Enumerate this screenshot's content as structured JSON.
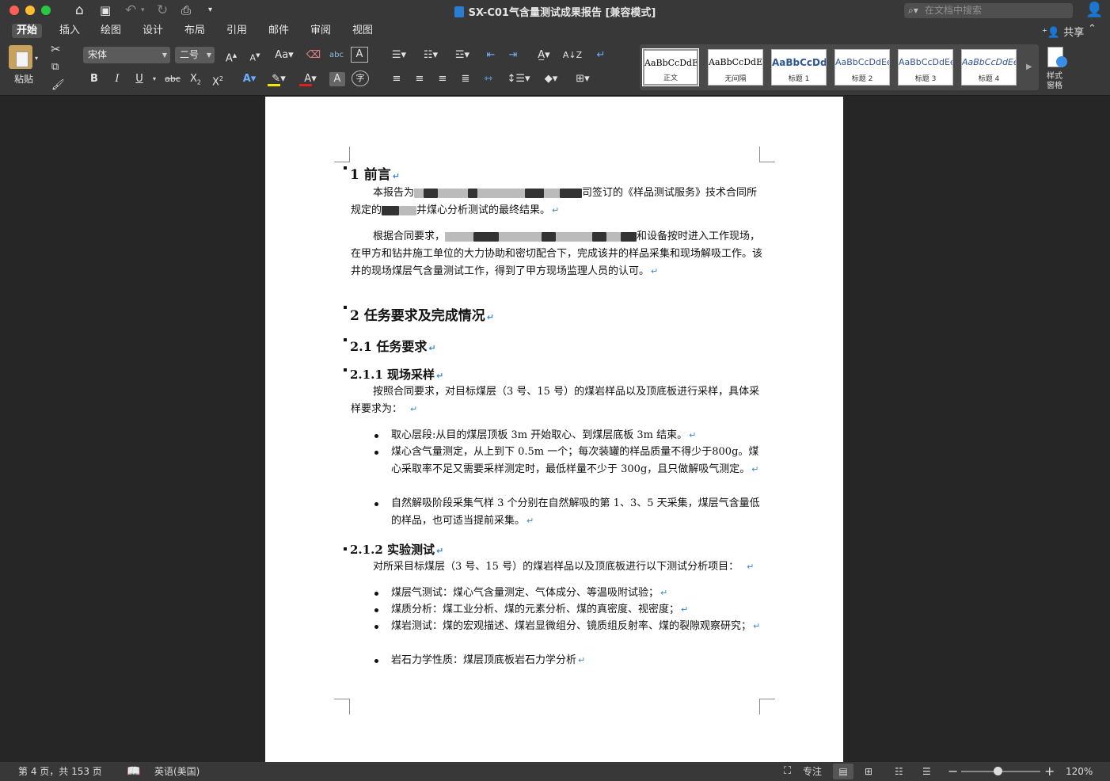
{
  "window": {
    "title": "SX-C01气含量测试成果报告 [兼容模式]",
    "search_placeholder": "在文档中搜索",
    "traffic_colors": [
      "#ff5f57",
      "#febc2e",
      "#28c840"
    ]
  },
  "tabs": [
    "开始",
    "插入",
    "绘图",
    "设计",
    "布局",
    "引用",
    "邮件",
    "审阅",
    "视图"
  ],
  "active_tab": "开始",
  "share_label": "共享",
  "ribbon": {
    "paste_label": "粘贴",
    "font_name": "宋体",
    "font_size": "二号",
    "bold": "B",
    "italic": "I",
    "underline": "U",
    "strikethrough": "abc",
    "subscript": "X",
    "superscript": "X",
    "styles": [
      {
        "sample": "AaBbCcDdEe",
        "name": "正文"
      },
      {
        "sample": "AaBbCcDdEe",
        "name": "无间隔"
      },
      {
        "sample": "AaBbCcDdI",
        "name": "标题 1"
      },
      {
        "sample": "AaBbCcDdEe",
        "name": "标题 2"
      },
      {
        "sample": "AaBbCcDdEe",
        "name": "标题 3"
      },
      {
        "sample": "AaBbCcDdEe",
        "name": "标题 4"
      }
    ],
    "styles_pane_label_1": "样式",
    "styles_pane_label_2": "窗格"
  },
  "document": {
    "h_preface": "1  前言",
    "p1_a": "本报告为",
    "p1_b": "司签订的《样品测试服务》技术合同所规定的",
    "p1_c": "井煤心分析测试的最终结果。",
    "p2_a": "根据合同要求，",
    "p2_b": "和设备按时进入工作现场，在甲方和钻井施工单位的大力协助和密切配合下，完成该井的样品采集和现场解吸工作。该井的现场煤层气含量测试工作，得到了甲方现场监理人员的认可。",
    "h_task": "2  任务要求及完成情况",
    "h_task_req": "2.1  任务要求",
    "h_sampling": "2.1.1  现场采样",
    "p_sampling": "按照合同要求，对目标煤层（3 号、15 号）的煤岩样品以及顶底板进行采样，具体采样要求为：",
    "sampling_items": [
      "取心层段:从目的煤层顶板 3m 开始取心、到煤层底板 3m 结束。",
      "煤心含气量测定，从上到下 0.5m 一个；每次装罐的样品质量不得少于800g。煤心采取率不足又需要采样测定时，最低样量不少于 300g，且只做解吸气测定。",
      "自然解吸阶段采集气样 3 个分别在自然解吸的第 1、3、5 天采集，煤层气含量低的样品，也可适当提前采集。"
    ],
    "h_lab": "2.1.2  实验测试",
    "p_lab": "对所采目标煤层（3 号、15 号）的煤岩样品以及顶底板进行以下测试分析项目：",
    "lab_items": [
      "煤层气测试：煤心气含量测定、气体成分、等温吸附试验；",
      "煤质分析：煤工业分析、煤的元素分析、煤的真密度、视密度；",
      "煤岩测试：煤的宏观描述、煤岩显微组分、镜质组反射率、煤的裂隙观察研究；",
      "岩石力学性质：煤层顶底板岩石力学分析"
    ],
    "return_mark": "↵"
  },
  "status": {
    "page": "第 4 页，共 153 页",
    "language": "英语(美国)",
    "focus": "专注",
    "zoom": "120%",
    "zoom_fraction": 0.46
  }
}
